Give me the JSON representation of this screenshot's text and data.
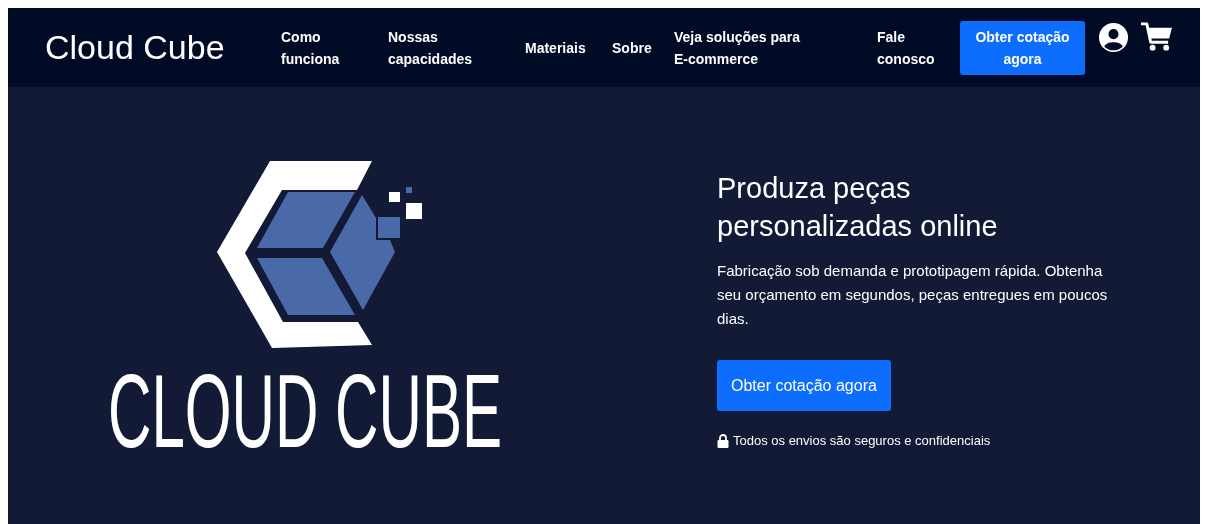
{
  "navbar": {
    "brand": "Cloud Cube",
    "links": [
      "Como funciona",
      "Nossas capacidades",
      "Materiais",
      "Sobre",
      "Veja soluções para E-commerce",
      "Fale conosco"
    ],
    "cta": "Obter cotação agora"
  },
  "hero": {
    "logo_text": "CLOUD CUBE",
    "title": "Produza peças personalizadas online",
    "text": "Fabricação sob demanda e prototipagem rápida. Obtenha seu orçamento em segundos, peças entregues em poucos dias.",
    "button": "Obter cotação agora",
    "note": "Todos os envios são seguros e confidenciais"
  }
}
